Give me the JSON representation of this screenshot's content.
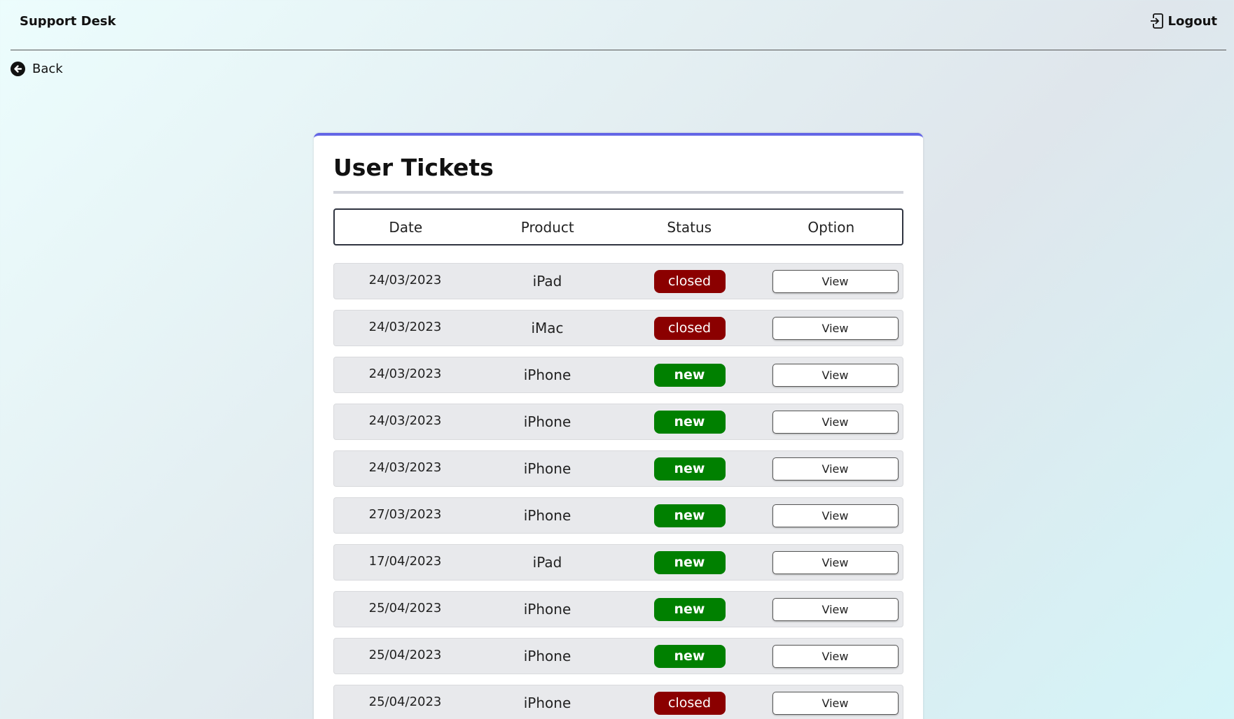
{
  "header": {
    "brand": "Support Desk",
    "logout_label": "Logout"
  },
  "nav": {
    "back_label": "Back"
  },
  "card": {
    "title": "User Tickets",
    "accent_color": "#6366e6"
  },
  "table": {
    "columns": [
      "Date",
      "Product",
      "Status",
      "Option"
    ],
    "status_colors": {
      "closed": "#8b0000",
      "new": "#008000"
    },
    "rows": [
      {
        "date": "24/03/2023",
        "product": "iPad",
        "status": "closed",
        "option": "View"
      },
      {
        "date": "24/03/2023",
        "product": "iMac",
        "status": "closed",
        "option": "View"
      },
      {
        "date": "24/03/2023",
        "product": "iPhone",
        "status": "new",
        "option": "View"
      },
      {
        "date": "24/03/2023",
        "product": "iPhone",
        "status": "new",
        "option": "View"
      },
      {
        "date": "24/03/2023",
        "product": "iPhone",
        "status": "new",
        "option": "View"
      },
      {
        "date": "27/03/2023",
        "product": "iPhone",
        "status": "new",
        "option": "View"
      },
      {
        "date": "17/04/2023",
        "product": "iPad",
        "status": "new",
        "option": "View"
      },
      {
        "date": "25/04/2023",
        "product": "iPhone",
        "status": "new",
        "option": "View"
      },
      {
        "date": "25/04/2023",
        "product": "iPhone",
        "status": "new",
        "option": "View"
      },
      {
        "date": "25/04/2023",
        "product": "iPhone",
        "status": "closed",
        "option": "View"
      }
    ]
  }
}
